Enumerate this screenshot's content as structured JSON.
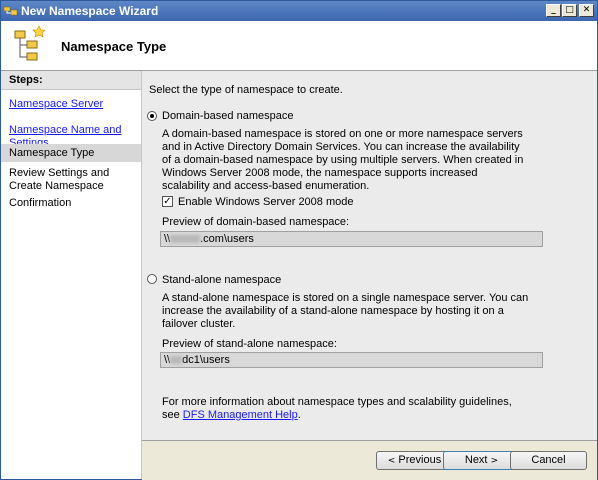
{
  "window": {
    "title": "New Namespace Wizard"
  },
  "header": {
    "title": "Namespace Type"
  },
  "sidebar": {
    "heading": "Steps:",
    "items": [
      {
        "label": "Namespace Server"
      },
      {
        "label": "Namespace Name and Settings"
      },
      {
        "label": "Namespace Type"
      },
      {
        "label": "Review Settings and Create Namespace"
      },
      {
        "label": "Confirmation"
      }
    ]
  },
  "main": {
    "intro": "Select the type of namespace to create.",
    "domain": {
      "label": "Domain-based namespace",
      "selected": true,
      "description": "A domain-based namespace is stored on one or more namespace servers and in Active Directory Domain Services. You can increase the availability of a domain-based namespace by using multiple servers. When created in Windows Server 2008 mode, the namespace supports increased scalability and access-based enumeration.",
      "checkbox_label": "Enable Windows Server 2008 mode",
      "checkbox_checked": true,
      "preview_label": "Preview of domain-based namespace:",
      "preview_prefix": "\\\\",
      "preview_suffix": ".com\\users"
    },
    "standalone": {
      "label": "Stand-alone namespace",
      "selected": false,
      "description": "A stand-alone namespace is stored on a single namespace server. You can increase the availability of a stand-alone namespace by hosting it on a failover cluster.",
      "preview_label": "Preview of stand-alone namespace:",
      "preview_prefix": "\\\\",
      "preview_suffix": "dc1\\users"
    },
    "help_text": "For more information about namespace types and scalability guidelines, see ",
    "help_link": "DFS Management Help",
    "help_end": "."
  },
  "buttons": {
    "previous": "Previous",
    "next": "Next",
    "cancel": "Cancel"
  }
}
